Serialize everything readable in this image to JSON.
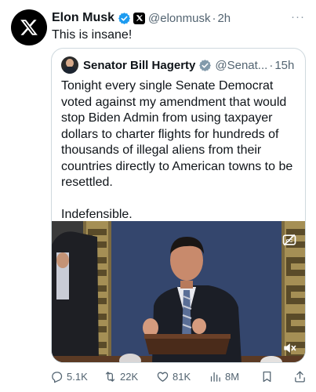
{
  "tweet": {
    "author_name": "Elon Musk",
    "author_handle": "@elonmusk",
    "separator": "·",
    "time": "2h",
    "more_label": "···",
    "text": "This is insane!"
  },
  "quote": {
    "author_name": "Senator Bill Hagerty",
    "author_handle": "@Senat...",
    "separator": "·",
    "time": "15h",
    "paragraph1": "Tonight every single Senate Democrat voted against my amendment that would stop Biden Admin from using taxpayer dollars to charter flights for hundreds of thousands of illegal aliens from their countries directly to American towns to be resettled.",
    "paragraph2": "Indefensible."
  },
  "actions": {
    "replies": "5.1K",
    "reposts": "22K",
    "likes": "81K",
    "views": "8M"
  },
  "colors": {
    "verified_blue": "#1d9bf0",
    "text_secondary": "#536471",
    "border": "#cfd9de"
  },
  "icons": [
    "x-logo-icon",
    "verified-badge-icon",
    "x-affiliate-badge-icon",
    "more-icon",
    "captions-icon",
    "mute-icon",
    "reply-icon",
    "repost-icon",
    "like-icon",
    "views-icon",
    "bookmark-icon",
    "share-icon"
  ]
}
